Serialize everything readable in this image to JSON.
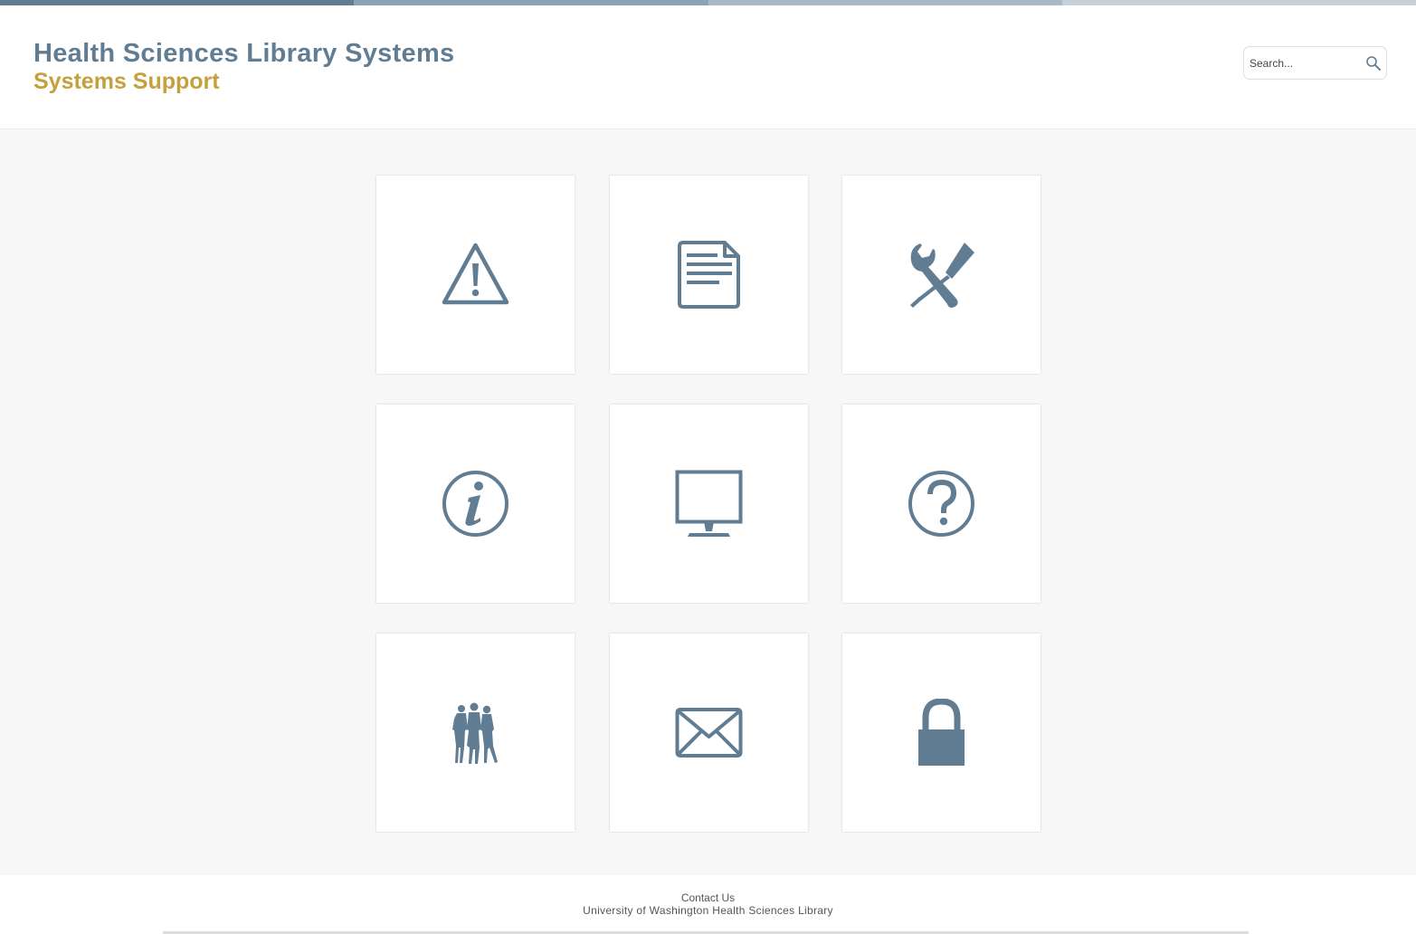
{
  "header": {
    "title": "Health Sciences Library Systems",
    "subtitle": "Systems Support"
  },
  "search": {
    "placeholder": "Search..."
  },
  "colors": {
    "title": "#617d93",
    "subtitle": "#c5a03d",
    "icon": "#617d93",
    "background": "#f7f7f7",
    "top_bar": [
      "#617d93",
      "#8da2b2",
      "#a9b9c5",
      "#c5d0d8"
    ]
  },
  "tiles": [
    {
      "icon": "warning-icon"
    },
    {
      "icon": "document-icon"
    },
    {
      "icon": "tools-icon"
    },
    {
      "icon": "info-icon"
    },
    {
      "icon": "monitor-icon"
    },
    {
      "icon": "help-icon"
    },
    {
      "icon": "people-icon"
    },
    {
      "icon": "mail-icon"
    },
    {
      "icon": "lock-icon"
    }
  ],
  "footer": {
    "contact": "Contact Us",
    "organization": "University of Washington Health Sciences Library"
  }
}
